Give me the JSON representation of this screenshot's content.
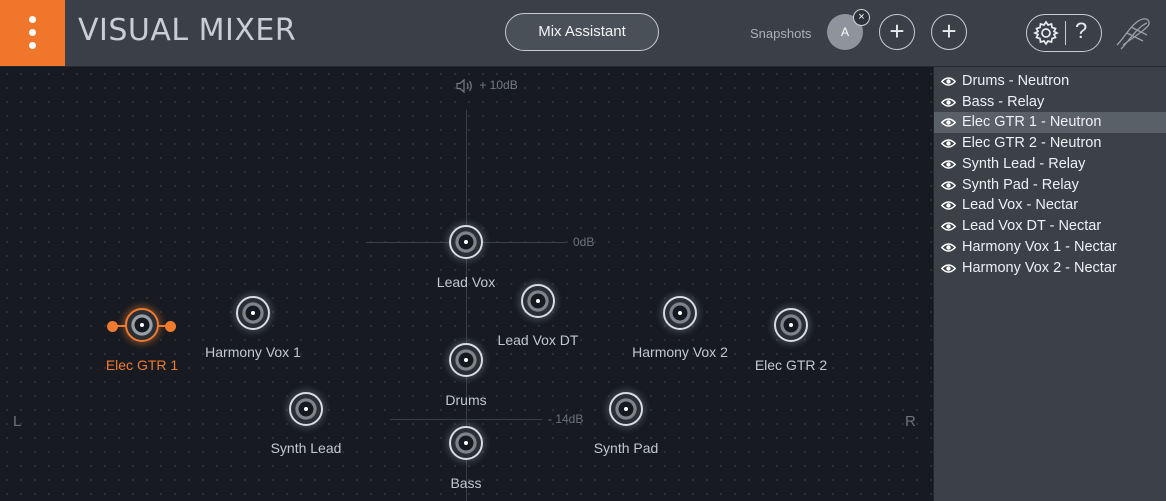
{
  "header": {
    "title": "VISUAL MIXER",
    "mix_assistant_label": "Mix Assistant",
    "snapshots_label": "Snapshots",
    "snapshot_a_label": "A",
    "snapshot_close_glyph": "×",
    "add_glyph": "+",
    "help_glyph": "?"
  },
  "mixer": {
    "volume_top_label": "+ 10dB",
    "db_mid_label": "0dB",
    "db_low_label": "- 14dB",
    "left_label": "L",
    "right_label": "R",
    "nodes": [
      {
        "label": "Lead Vox"
      },
      {
        "label": "Lead Vox DT"
      },
      {
        "label": "Harmony Vox 1"
      },
      {
        "label": "Harmony Vox 2"
      },
      {
        "label": "Elec GTR 1"
      },
      {
        "label": "Elec GTR 2"
      },
      {
        "label": "Drums"
      },
      {
        "label": "Synth Lead"
      },
      {
        "label": "Synth Pad"
      },
      {
        "label": "Bass"
      }
    ]
  },
  "tracks": [
    {
      "label": "Drums - Neutron"
    },
    {
      "label": "Bass - Relay"
    },
    {
      "label": "Elec GTR 1 - Neutron"
    },
    {
      "label": "Elec GTR 2 - Neutron"
    },
    {
      "label": "Synth Lead - Relay"
    },
    {
      "label": "Synth Pad - Relay"
    },
    {
      "label": "Lead Vox - Nectar"
    },
    {
      "label": "Lead Vox DT - Nectar"
    },
    {
      "label": "Harmony Vox 1 - Nectar"
    },
    {
      "label": "Harmony Vox 2 - Nectar"
    }
  ],
  "colors": {
    "accent": "#f07a30",
    "header_bg": "#3b4048",
    "mixer_bg": "#171b21",
    "panel_bg": "#3c4148",
    "selected_row": "#5a6068"
  },
  "icons": [
    "menu-dots-icon",
    "gear-icon",
    "help-icon",
    "speaker-icon",
    "eye-icon",
    "logo-icon"
  ]
}
